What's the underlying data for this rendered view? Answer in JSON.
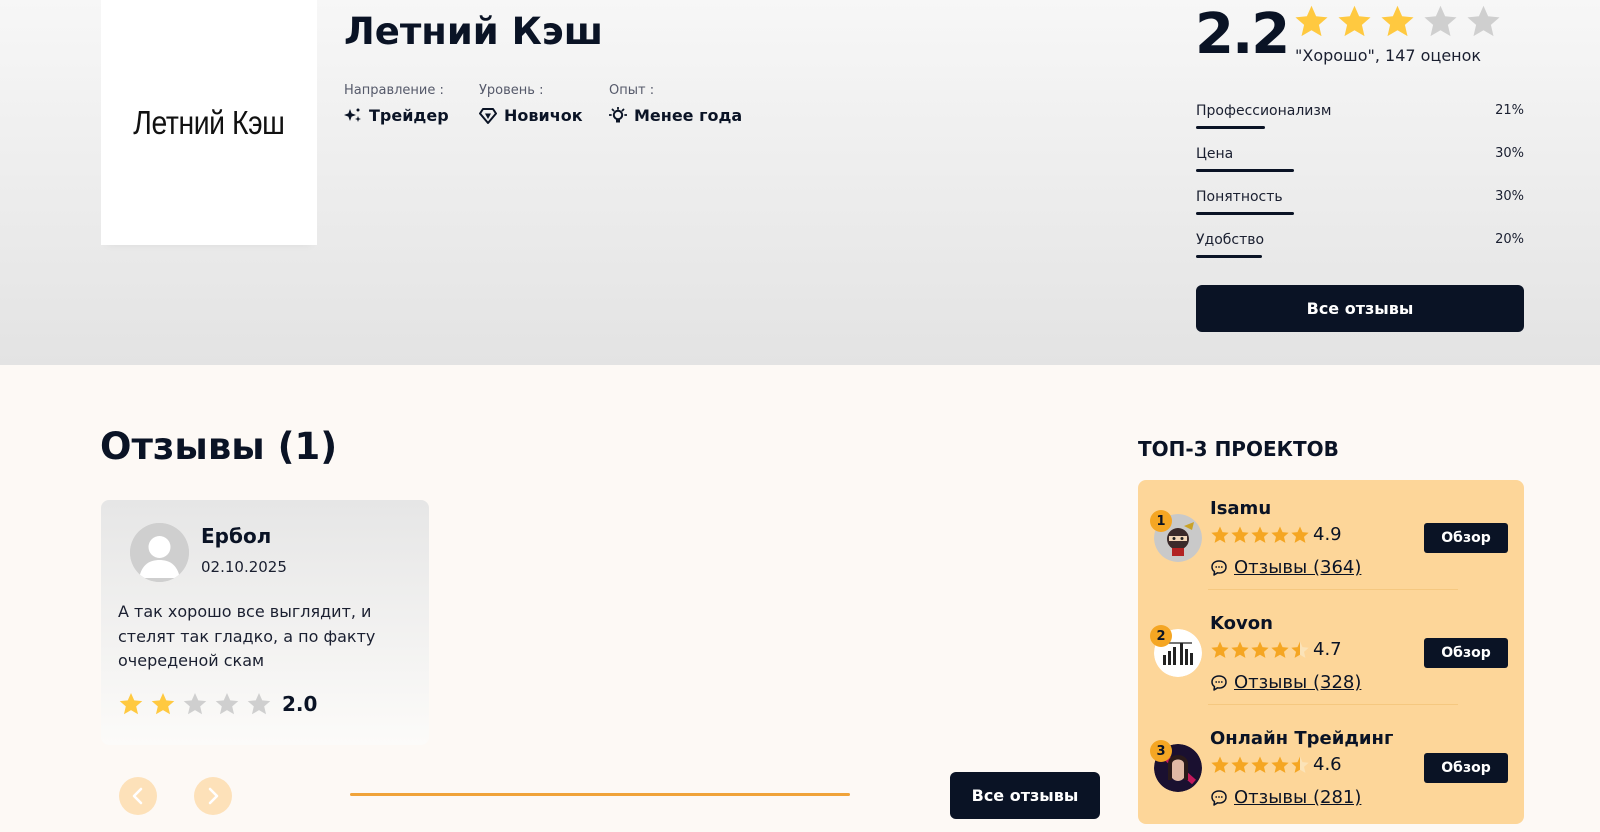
{
  "project": {
    "logo_text": "Летний Кэш",
    "title": "Летний Кэш",
    "meta": [
      {
        "label": "Направление :",
        "value": "Трейдер",
        "icon": "sparkles-icon"
      },
      {
        "label": "Уровень :",
        "value": "Новичок",
        "icon": "diamond-icon"
      },
      {
        "label": "Опыт :",
        "value": "Менее года",
        "icon": "lightbulb-icon"
      }
    ]
  },
  "rating": {
    "score": "2.2",
    "stars_filled": 3,
    "stars_total": 5,
    "summary": "\"Хорошо\", 147 оценок",
    "criteria": [
      {
        "label": "Профессионализм",
        "percent": "21%",
        "value": 0.21
      },
      {
        "label": "Цена",
        "percent": "30%",
        "value": 0.3
      },
      {
        "label": "Понятность",
        "percent": "30%",
        "value": 0.3
      },
      {
        "label": "Удобство",
        "percent": "20%",
        "value": 0.2
      }
    ],
    "all_reviews_button": "Все отзывы"
  },
  "reviews": {
    "title": "Отзывы (1)",
    "items": [
      {
        "name": "Ербол",
        "date": "02.10.2025",
        "text": "А так хорошо все выглядит, и стелят так гладко, а по факту очереденой скам",
        "stars_filled": 2,
        "score": "2.0"
      }
    ],
    "slider_progress": 1.0,
    "all_reviews_button": "Все отзывы"
  },
  "top3": {
    "title": "ТОП-3 ПРОЕКТОВ",
    "items": [
      {
        "rank": "1",
        "name": "Isamu",
        "score": "4.9",
        "stars": 5,
        "reviews": "Отзывы (364)",
        "button": "Обзор"
      },
      {
        "rank": "2",
        "name": "Kovon",
        "score": "4.7",
        "stars": 4.5,
        "reviews": "Отзывы (328)",
        "button": "Обзор"
      },
      {
        "rank": "3",
        "name": "Онлайн Трейдинг",
        "score": "4.6",
        "stars": 4.5,
        "reviews": "Отзывы (281)",
        "button": "Обзор"
      }
    ]
  },
  "colors": {
    "dark": "#0a1325",
    "star": "#ffc940",
    "star_empty": "#cfcfcf",
    "accent": "#f5a623",
    "panel": "#fdd699"
  }
}
